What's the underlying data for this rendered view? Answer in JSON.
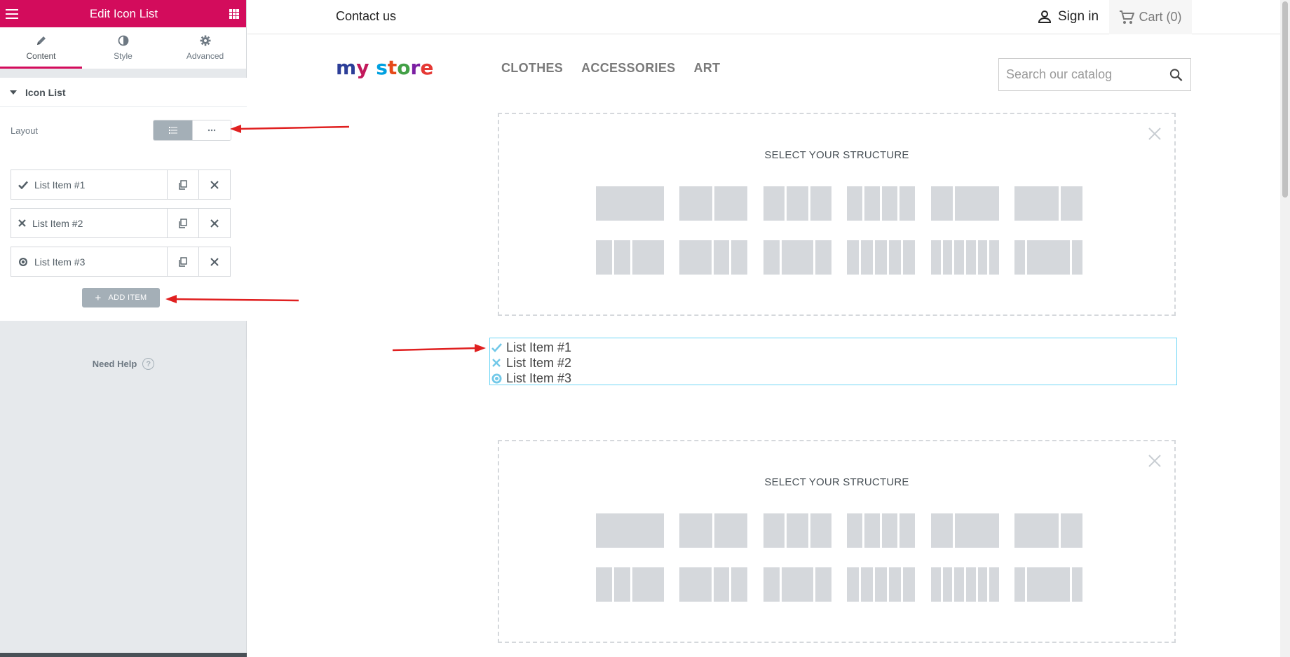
{
  "panel": {
    "title": "Edit Icon List",
    "tabs": [
      {
        "label": "Content"
      },
      {
        "label": "Style"
      },
      {
        "label": "Advanced"
      }
    ],
    "section_title": "Icon List",
    "layout_label": "Layout",
    "layout_options": [
      "list",
      "inline"
    ],
    "items": [
      {
        "label": "List Item #1",
        "icon": "check-icon"
      },
      {
        "label": "List Item #2",
        "icon": "times-icon"
      },
      {
        "label": "List Item #3",
        "icon": "dot-circle-icon"
      }
    ],
    "add_item_label": "ADD ITEM",
    "need_help_label": "Need Help",
    "accent_color": "#d30c5c"
  },
  "preview": {
    "contact_label": "Contact us",
    "signin_label": "Sign in",
    "cart_label": "Cart (0)",
    "logo_text": "my store",
    "nav": [
      "CLOTHES",
      "ACCESSORIES",
      "ART"
    ],
    "search_placeholder": "Search our catalog",
    "structure_heading": "SELECT YOUR STRUCTURE",
    "list_items": [
      {
        "label": "List Item #1",
        "icon": "check-icon"
      },
      {
        "label": "List Item #2",
        "icon": "times-icon"
      },
      {
        "label": "List Item #3",
        "icon": "dot-circle-icon"
      }
    ],
    "icon_color": "#61ce70",
    "highlight_color": "#71d7f7"
  }
}
